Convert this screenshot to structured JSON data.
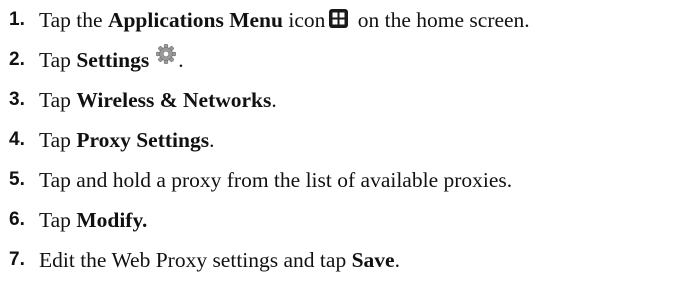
{
  "steps": [
    {
      "number": "1.",
      "parts": {
        "a": "Tap the ",
        "b": "Applications Menu",
        "c": " icon",
        "d": " on the home screen."
      },
      "icon": "applications-menu-icon"
    },
    {
      "number": "2.",
      "parts": {
        "a": "Tap ",
        "b": "Settings",
        "c": "."
      },
      "icon": "settings-gear-icon"
    },
    {
      "number": "3.",
      "parts": {
        "a": "Tap ",
        "b": "Wireless & Networks",
        "c": "."
      }
    },
    {
      "number": "4.",
      "parts": {
        "a": "Tap ",
        "b": "Proxy Settings",
        "c": "."
      }
    },
    {
      "number": "5.",
      "parts": {
        "a": "Tap and hold a proxy from the list of available proxies."
      }
    },
    {
      "number": "6.",
      "parts": {
        "a": "Tap ",
        "b": "Modify."
      }
    },
    {
      "number": "7.",
      "parts": {
        "a": "Edit the Web Proxy settings and tap ",
        "b": "Save",
        "c": "."
      }
    }
  ]
}
